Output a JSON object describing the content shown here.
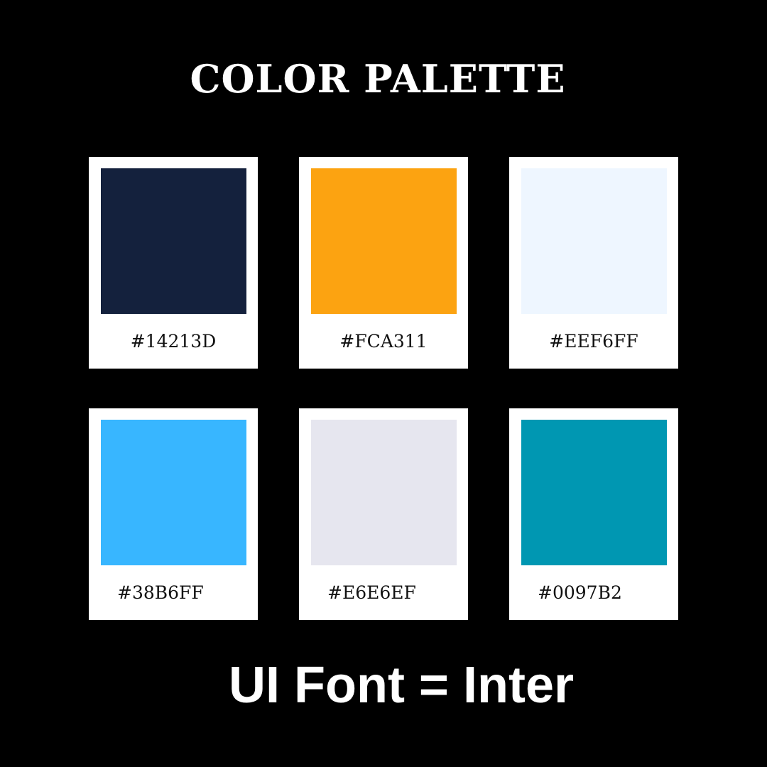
{
  "title": "COLOR PALETTE",
  "footer": "UI Font = Inter",
  "swatches": [
    {
      "hex": "#14213D",
      "color": "#14213D"
    },
    {
      "hex": "#FCA311",
      "color": "#FCA311"
    },
    {
      "hex": "#EEF6FF",
      "color": "#EEF6FF"
    },
    {
      "hex": "#38B6FF",
      "color": "#38B6FF"
    },
    {
      "hex": "#E6E6EF",
      "color": "#E6E6EF"
    },
    {
      "hex": "#0097B2",
      "color": "#0097B2"
    }
  ]
}
